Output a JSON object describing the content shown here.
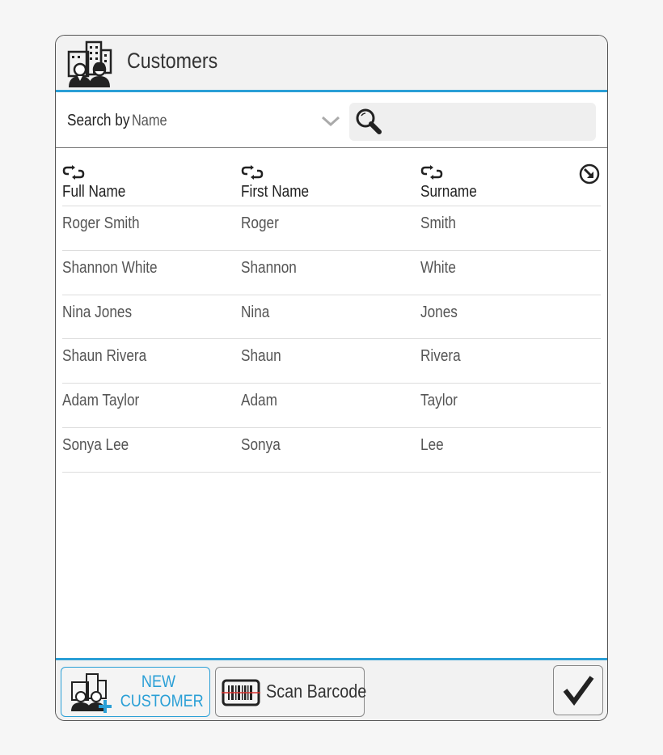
{
  "window": {
    "title": "Customers"
  },
  "search": {
    "label": "Search by",
    "field": "Name",
    "placeholder": ""
  },
  "table": {
    "columns": [
      "Full Name",
      "First Name",
      "Surname"
    ],
    "rows": [
      [
        "Roger Smith",
        "Roger",
        "Smith"
      ],
      [
        "Shannon White",
        "Shannon",
        "White"
      ],
      [
        "Nina Jones",
        "Nina",
        "Jones"
      ],
      [
        "Shaun Rivera",
        "Shaun",
        "Rivera"
      ],
      [
        "Adam Taylor",
        "Adam",
        "Taylor"
      ],
      [
        "Sonya Lee",
        "Sonya",
        "Lee"
      ]
    ]
  },
  "footer": {
    "new_customer_line1": "NEW",
    "new_customer_line2": "CUSTOMER",
    "scan_label": "Scan Barcode"
  },
  "colors": {
    "accent": "#2a9fd6",
    "text": "#333333"
  }
}
